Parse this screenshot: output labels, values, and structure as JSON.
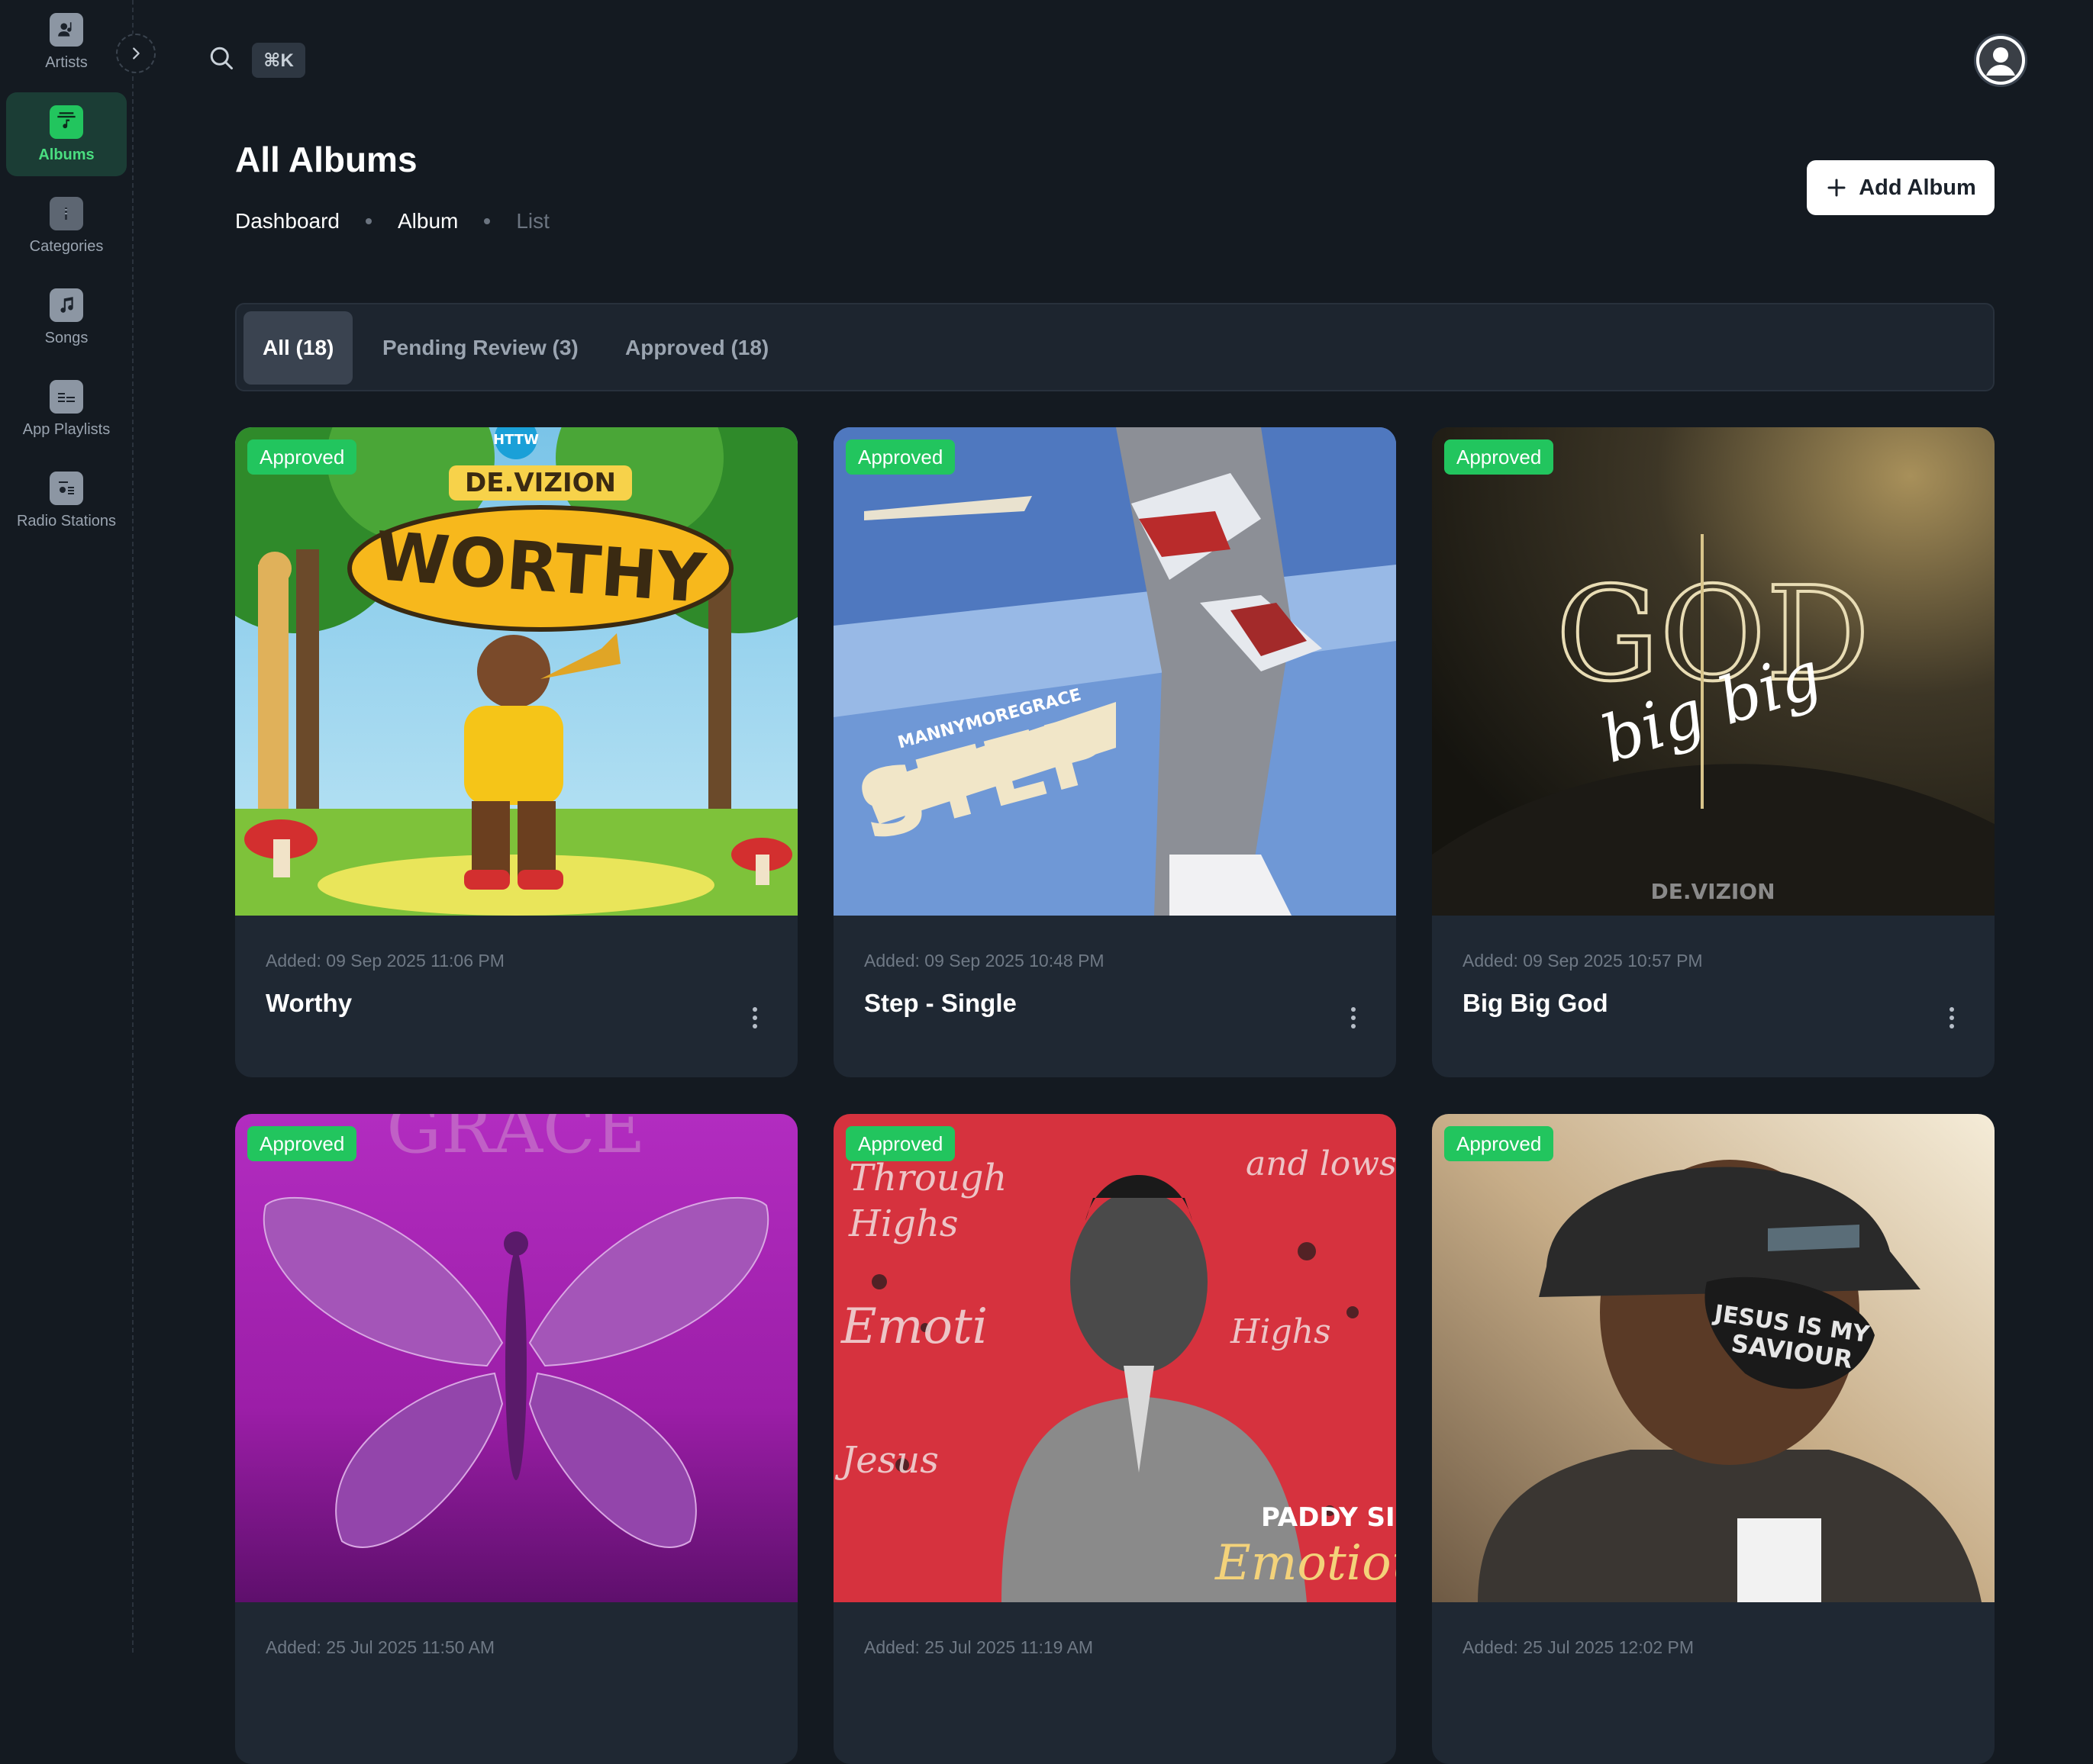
{
  "sidebar": {
    "items": [
      {
        "label": "Artists",
        "icon": "artist-icon"
      },
      {
        "label": "Albums",
        "icon": "album-icon",
        "active": true
      },
      {
        "label": "Categories",
        "icon": "folder-icon"
      },
      {
        "label": "Songs",
        "icon": "music-note-icon"
      },
      {
        "label": "App Playlists",
        "icon": "playlist-icon"
      },
      {
        "label": "Radio Stations",
        "icon": "radio-icon"
      }
    ],
    "collapse_icon": "chevron-right-icon"
  },
  "topbar": {
    "search_icon": "search-icon",
    "shortcut": "⌘K",
    "avatar_icon": "user-avatar-icon"
  },
  "header": {
    "title": "All Albums",
    "breadcrumb": [
      "Dashboard",
      "Album",
      "List"
    ],
    "add_button": "Add Album"
  },
  "tabs": [
    {
      "label": "All (18)",
      "active": true
    },
    {
      "label": "Pending Review (3)"
    },
    {
      "label": "Approved (18)"
    }
  ],
  "albums": [
    {
      "badge": "Approved",
      "added": "Added: 09 Sep 2025 11:06 PM",
      "title": "Worthy",
      "art_text": [
        "HTTW",
        "DE.VIZION",
        "WORTHY"
      ]
    },
    {
      "badge": "Approved",
      "added": "Added: 09 Sep 2025 10:48 PM",
      "title": "Step - Single",
      "art_text": [
        "MANNYMOREGRACE",
        "STEP"
      ]
    },
    {
      "badge": "Approved",
      "added": "Added: 09 Sep 2025 10:57 PM",
      "title": "Big Big God",
      "art_text": [
        "GOD",
        "big big",
        "DE.VIZION"
      ]
    },
    {
      "badge": "Approved",
      "added": "Added: 25 Jul 2025 11:50 AM",
      "title": "",
      "art_text": [
        "GRACE"
      ]
    },
    {
      "badge": "Approved",
      "added": "Added: 25 Jul 2025 11:19 AM",
      "title": "",
      "art_text": [
        "PADDY SIMBA",
        "Emotious"
      ]
    },
    {
      "badge": "Approved",
      "added": "Added: 25 Jul 2025 12:02 PM",
      "title": "",
      "art_text": [
        "JESUS IS MY",
        "SAVIOUR"
      ]
    }
  ],
  "colors": {
    "background": "#141a21",
    "card": "#1f2833",
    "accent": "#22c55e",
    "active_nav_bg": "#1b3d35"
  }
}
